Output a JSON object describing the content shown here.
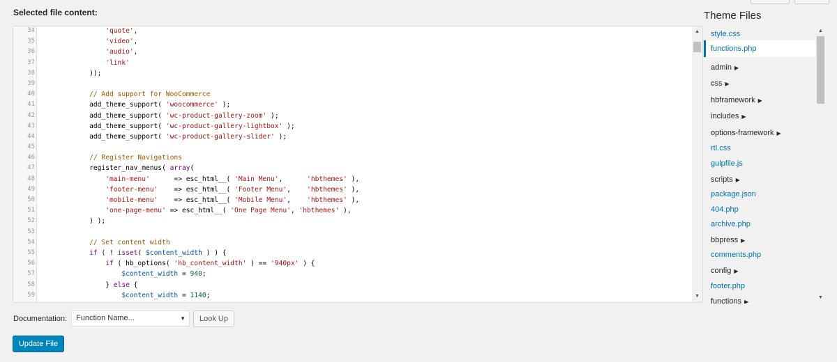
{
  "header": {
    "label": "Selected file content:"
  },
  "editor": {
    "lines": [
      {
        "n": "34",
        "tokens": [
          {
            "t": "        ",
            "c": "plain"
          },
          {
            "t": "'quote'",
            "c": "str"
          },
          {
            "t": ",",
            "c": "plain"
          }
        ]
      },
      {
        "n": "35",
        "tokens": [
          {
            "t": "        ",
            "c": "plain"
          },
          {
            "t": "'video'",
            "c": "str"
          },
          {
            "t": ",",
            "c": "plain"
          }
        ]
      },
      {
        "n": "36",
        "tokens": [
          {
            "t": "        ",
            "c": "plain"
          },
          {
            "t": "'audio'",
            "c": "str"
          },
          {
            "t": ",",
            "c": "plain"
          }
        ]
      },
      {
        "n": "37",
        "tokens": [
          {
            "t": "        ",
            "c": "plain"
          },
          {
            "t": "'link'",
            "c": "str"
          }
        ]
      },
      {
        "n": "38",
        "tokens": [
          {
            "t": "    ));",
            "c": "plain"
          }
        ]
      },
      {
        "n": "39",
        "tokens": []
      },
      {
        "n": "40",
        "tokens": [
          {
            "t": "    ",
            "c": "plain"
          },
          {
            "t": "// Add support for WooCommerce",
            "c": "com"
          }
        ]
      },
      {
        "n": "41",
        "tokens": [
          {
            "t": "    add_theme_support( ",
            "c": "plain"
          },
          {
            "t": "'woocommerce'",
            "c": "str"
          },
          {
            "t": " );",
            "c": "plain"
          }
        ]
      },
      {
        "n": "42",
        "tokens": [
          {
            "t": "    add_theme_support( ",
            "c": "plain"
          },
          {
            "t": "'wc-product-gallery-zoom'",
            "c": "str"
          },
          {
            "t": " );",
            "c": "plain"
          }
        ]
      },
      {
        "n": "43",
        "tokens": [
          {
            "t": "    add_theme_support( ",
            "c": "plain"
          },
          {
            "t": "'wc-product-gallery-lightbox'",
            "c": "str"
          },
          {
            "t": " );",
            "c": "plain"
          }
        ]
      },
      {
        "n": "44",
        "tokens": [
          {
            "t": "    add_theme_support( ",
            "c": "plain"
          },
          {
            "t": "'wc-product-gallery-slider'",
            "c": "str"
          },
          {
            "t": " );",
            "c": "plain"
          }
        ]
      },
      {
        "n": "45",
        "tokens": []
      },
      {
        "n": "46",
        "tokens": [
          {
            "t": "    ",
            "c": "plain"
          },
          {
            "t": "// Register Navigations",
            "c": "com"
          }
        ]
      },
      {
        "n": "47",
        "tokens": [
          {
            "t": "    register_nav_menus( ",
            "c": "plain"
          },
          {
            "t": "array",
            "c": "kw"
          },
          {
            "t": "(",
            "c": "plain"
          }
        ]
      },
      {
        "n": "48",
        "tokens": [
          {
            "t": "        ",
            "c": "plain"
          },
          {
            "t": "'main-menu'",
            "c": "str"
          },
          {
            "t": "      => esc_html__( ",
            "c": "plain"
          },
          {
            "t": "'Main Menu'",
            "c": "str"
          },
          {
            "t": ",      ",
            "c": "plain"
          },
          {
            "t": "'hbthemes'",
            "c": "str"
          },
          {
            "t": " ),",
            "c": "plain"
          }
        ]
      },
      {
        "n": "49",
        "tokens": [
          {
            "t": "        ",
            "c": "plain"
          },
          {
            "t": "'footer-menu'",
            "c": "str"
          },
          {
            "t": "    => esc_html__( ",
            "c": "plain"
          },
          {
            "t": "'Footer Menu'",
            "c": "str"
          },
          {
            "t": ",    ",
            "c": "plain"
          },
          {
            "t": "'hbthemes'",
            "c": "str"
          },
          {
            "t": " ),",
            "c": "plain"
          }
        ]
      },
      {
        "n": "50",
        "tokens": [
          {
            "t": "        ",
            "c": "plain"
          },
          {
            "t": "'mobile-menu'",
            "c": "str"
          },
          {
            "t": "    => esc_html__( ",
            "c": "plain"
          },
          {
            "t": "'Mobile Menu'",
            "c": "str"
          },
          {
            "t": ",    ",
            "c": "plain"
          },
          {
            "t": "'hbthemes'",
            "c": "str"
          },
          {
            "t": " ),",
            "c": "plain"
          }
        ]
      },
      {
        "n": "51",
        "tokens": [
          {
            "t": "        ",
            "c": "plain"
          },
          {
            "t": "'one-page-menu'",
            "c": "str"
          },
          {
            "t": " => esc_html__( ",
            "c": "plain"
          },
          {
            "t": "'One Page Menu'",
            "c": "str"
          },
          {
            "t": ", ",
            "c": "plain"
          },
          {
            "t": "'hbthemes'",
            "c": "str"
          },
          {
            "t": " ),",
            "c": "plain"
          }
        ]
      },
      {
        "n": "52",
        "tokens": [
          {
            "t": "    ) );",
            "c": "plain"
          }
        ]
      },
      {
        "n": "53",
        "tokens": []
      },
      {
        "n": "54",
        "tokens": [
          {
            "t": "    ",
            "c": "plain"
          },
          {
            "t": "// Set content width",
            "c": "com"
          }
        ]
      },
      {
        "n": "55",
        "tokens": [
          {
            "t": "    ",
            "c": "plain"
          },
          {
            "t": "if",
            "c": "kw"
          },
          {
            "t": " ( ! ",
            "c": "plain"
          },
          {
            "t": "isset",
            "c": "kw"
          },
          {
            "t": "( ",
            "c": "plain"
          },
          {
            "t": "$content_width",
            "c": "var"
          },
          {
            "t": " ) ) {",
            "c": "plain"
          }
        ]
      },
      {
        "n": "56",
        "tokens": [
          {
            "t": "        ",
            "c": "plain"
          },
          {
            "t": "if",
            "c": "kw"
          },
          {
            "t": " ( hb_options( ",
            "c": "plain"
          },
          {
            "t": "'hb_content_width'",
            "c": "str"
          },
          {
            "t": " ) == ",
            "c": "plain"
          },
          {
            "t": "'940px'",
            "c": "str"
          },
          {
            "t": " ) {",
            "c": "plain"
          }
        ]
      },
      {
        "n": "57",
        "tokens": [
          {
            "t": "            ",
            "c": "plain"
          },
          {
            "t": "$content_width",
            "c": "var"
          },
          {
            "t": " = ",
            "c": "plain"
          },
          {
            "t": "940",
            "c": "num"
          },
          {
            "t": ";",
            "c": "plain"
          }
        ]
      },
      {
        "n": "58",
        "tokens": [
          {
            "t": "        } ",
            "c": "plain"
          },
          {
            "t": "else",
            "c": "kw"
          },
          {
            "t": " {",
            "c": "plain"
          }
        ]
      },
      {
        "n": "59",
        "tokens": [
          {
            "t": "            ",
            "c": "plain"
          },
          {
            "t": "$content_width",
            "c": "var"
          },
          {
            "t": " = ",
            "c": "plain"
          },
          {
            "t": "1140",
            "c": "num"
          },
          {
            "t": ";",
            "c": "plain"
          }
        ]
      },
      {
        "n": "",
        "tokens": [
          {
            "t": "        }",
            "c": "plain"
          }
        ]
      }
    ]
  },
  "theme_files": {
    "title": "Theme Files",
    "items": [
      {
        "label": "style.css",
        "type": "file",
        "active": false
      },
      {
        "label": "functions.php",
        "type": "file",
        "active": true
      },
      {
        "label": "admin",
        "type": "folder",
        "active": false
      },
      {
        "label": "css",
        "type": "folder",
        "active": false
      },
      {
        "label": "hbframework",
        "type": "folder",
        "active": false
      },
      {
        "label": "includes",
        "type": "folder",
        "active": false
      },
      {
        "label": "options-framework",
        "type": "folder",
        "active": false
      },
      {
        "label": "rtl.css",
        "type": "file",
        "active": false
      },
      {
        "label": "gulpfile.js",
        "type": "file",
        "active": false
      },
      {
        "label": "scripts",
        "type": "folder",
        "active": false
      },
      {
        "label": "package.json",
        "type": "file",
        "active": false
      },
      {
        "label": "404.php",
        "type": "file",
        "active": false
      },
      {
        "label": "archive.php",
        "type": "file",
        "active": false
      },
      {
        "label": "bbpress",
        "type": "folder",
        "active": false
      },
      {
        "label": "comments.php",
        "type": "file",
        "active": false
      },
      {
        "label": "config",
        "type": "folder",
        "active": false
      },
      {
        "label": "footer.php",
        "type": "file",
        "active": false
      },
      {
        "label": "functions",
        "type": "folder",
        "active": false
      }
    ]
  },
  "documentation": {
    "label": "Documentation:",
    "select_value": "Function Name...",
    "lookup_label": "Look Up"
  },
  "update_label": "Update File",
  "icons": {
    "folder_arrow": "triangle-right-icon",
    "select_caret": "triangle-down-icon"
  },
  "colors": {
    "accent": "#0073aa",
    "button_primary": "#0085ba",
    "string": "#aa1111",
    "comment": "#aa5500",
    "keyword": "#770088",
    "variable": "#0055aa",
    "number": "#116644"
  }
}
